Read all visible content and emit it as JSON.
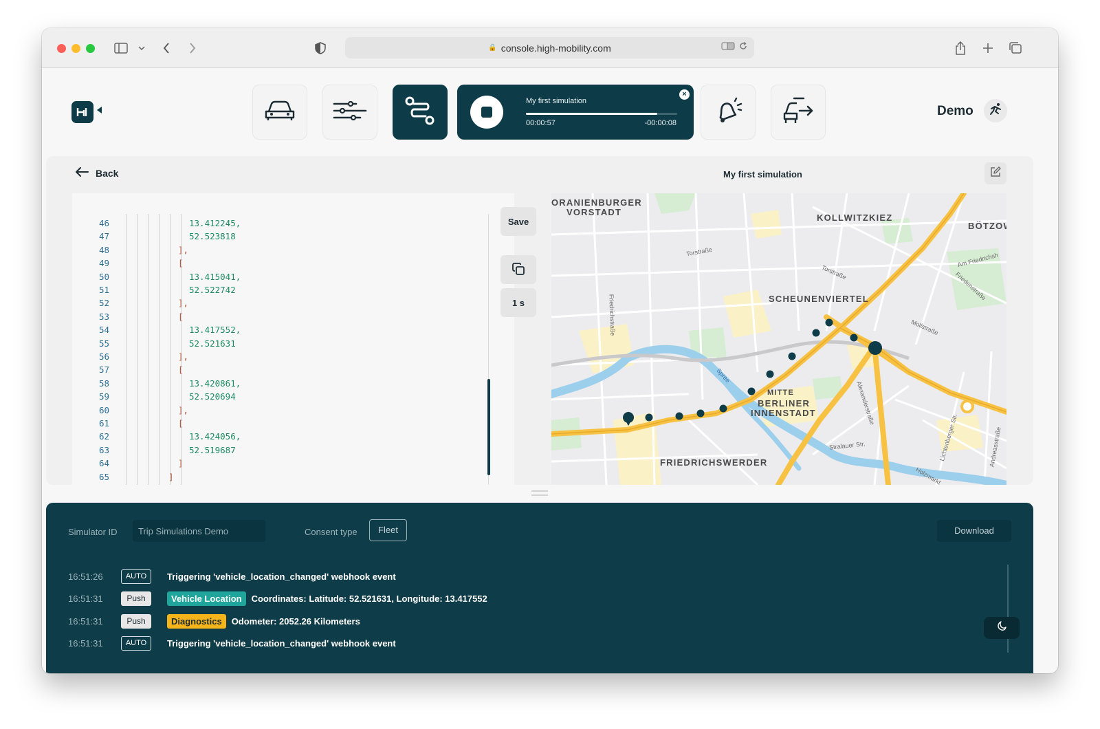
{
  "browser": {
    "url": "console.high-mobility.com"
  },
  "header": {
    "nav": [
      {
        "name": "vehicles",
        "icon": "car-icon"
      },
      {
        "name": "settings",
        "icon": "sliders-icon"
      },
      {
        "name": "trips",
        "icon": "route-icon",
        "active": true
      },
      {
        "name": "notifications",
        "icon": "alert-bell-icon"
      },
      {
        "name": "exit",
        "icon": "car-exit-icon"
      }
    ],
    "simulation": {
      "title": "My first simulation",
      "elapsed": "00:00:57",
      "remaining": "-00:00:08",
      "progress": 0.87
    },
    "user": {
      "name": "Demo"
    }
  },
  "panel": {
    "back_label": "Back",
    "title": "My first simulation",
    "save_label": "Save",
    "interval_label": "1 s"
  },
  "editor": {
    "lines": [
      {
        "n": "46",
        "text": "13.412245,",
        "kind": "num"
      },
      {
        "n": "47",
        "text": "52.523818",
        "kind": "num"
      },
      {
        "n": "48",
        "text": "],",
        "kind": "close"
      },
      {
        "n": "49",
        "text": "[",
        "kind": "open"
      },
      {
        "n": "50",
        "text": "13.415041,",
        "kind": "num"
      },
      {
        "n": "51",
        "text": "52.522742",
        "kind": "num"
      },
      {
        "n": "52",
        "text": "],",
        "kind": "close"
      },
      {
        "n": "53",
        "text": "[",
        "kind": "open"
      },
      {
        "n": "54",
        "text": "13.417552,",
        "kind": "num"
      },
      {
        "n": "55",
        "text": "52.521631",
        "kind": "num"
      },
      {
        "n": "56",
        "text": "],",
        "kind": "close"
      },
      {
        "n": "57",
        "text": "[",
        "kind": "open"
      },
      {
        "n": "58",
        "text": "13.420861,",
        "kind": "num"
      },
      {
        "n": "59",
        "text": "52.520694",
        "kind": "num"
      },
      {
        "n": "60",
        "text": "],",
        "kind": "close"
      },
      {
        "n": "61",
        "text": "[",
        "kind": "open"
      },
      {
        "n": "62",
        "text": "13.424056,",
        "kind": "num"
      },
      {
        "n": "63",
        "text": "52.519687",
        "kind": "num"
      },
      {
        "n": "64",
        "text": "]",
        "kind": "close"
      },
      {
        "n": "65",
        "text": "]",
        "kind": "outer"
      }
    ]
  },
  "map": {
    "districts": [
      "ORANIENBURGER",
      "VORSTADT",
      "KOLLWITZKIEZ",
      "BÖTZOW",
      "SCHEUNENVIERTEL",
      "MITTE",
      "BERLINER",
      "INNENSTADT",
      "FRIEDRICHSWERDER"
    ],
    "streets": [
      "Torstraße",
      "Torstraße",
      "Am Friedrichsh",
      "Friedenstraße",
      "Mollstraße",
      "Friedrichstraße",
      "Spree",
      "Alexanderstraße",
      "Stralauer Str.",
      "Lichtenberger Str.",
      "Andreasstraße",
      "Holzmarkt"
    ]
  },
  "console": {
    "simulator_id_label": "Simulator ID",
    "simulator_id_value": "Trip Simulations Demo",
    "consent_label": "Consent type",
    "consent_value": "Fleet",
    "download_label": "Download",
    "log": [
      {
        "time": "16:51:26",
        "badge": "AUTO",
        "tag": "",
        "tag_color": "",
        "message": "Triggering 'vehicle_location_changed' webhook event"
      },
      {
        "time": "16:51:31",
        "badge": "Push",
        "tag": "Vehicle Location",
        "tag_color": "teal",
        "message": "Coordinates: Latitude: 52.521631, Longitude: 13.417552"
      },
      {
        "time": "16:51:31",
        "badge": "Push",
        "tag": "Diagnostics",
        "tag_color": "yellow",
        "message": "Odometer: 2052.26 Kilometers"
      },
      {
        "time": "16:51:31",
        "badge": "AUTO",
        "tag": "",
        "tag_color": "",
        "message": "Triggering 'vehicle_location_changed' webhook event"
      }
    ]
  },
  "colors": {
    "brand": "#0d3c48",
    "route": "#f7c244",
    "teal_tag": "#1fa59c",
    "yellow_tag": "#f5b419"
  }
}
